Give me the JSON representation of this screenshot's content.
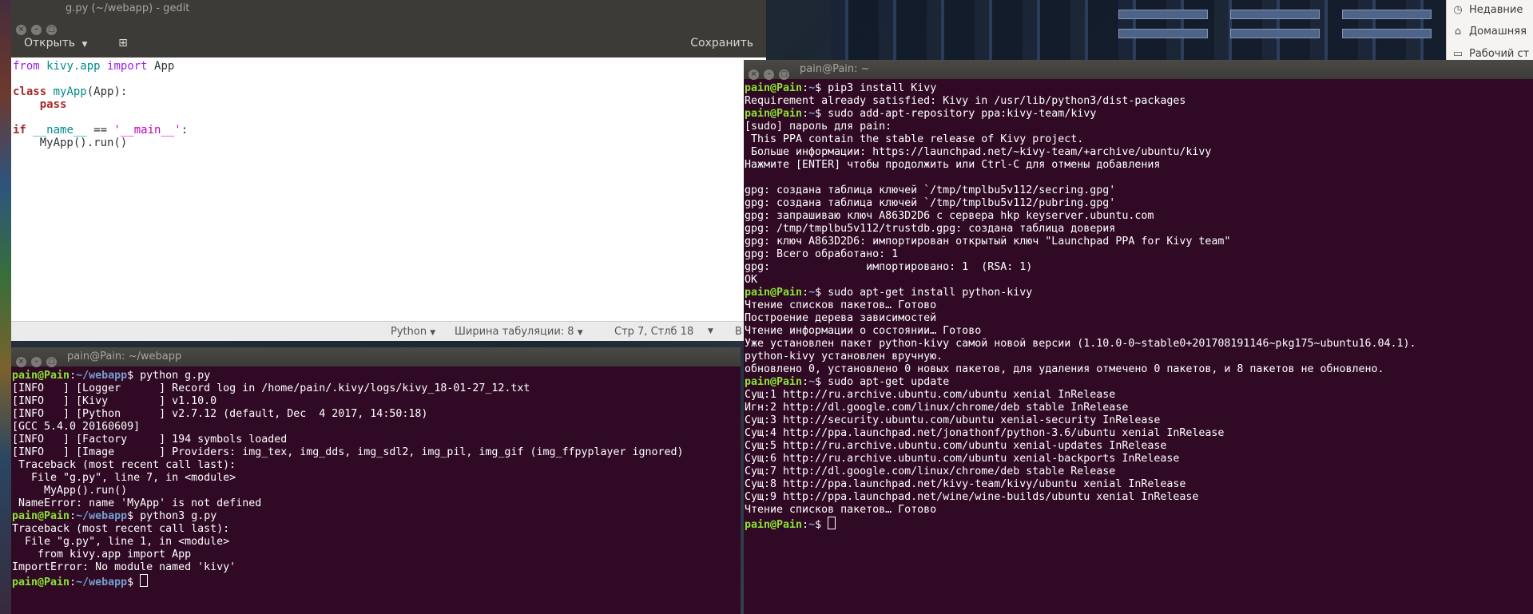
{
  "desktop": {
    "file_manager": {
      "items": [
        {
          "icon": "clock-icon",
          "label": "Недавние"
        },
        {
          "icon": "home-icon",
          "label": "Домашняя"
        },
        {
          "icon": "desktop-icon",
          "label": "Рабочий ст"
        }
      ]
    }
  },
  "gedit": {
    "title": "g.py (~/webapp) - gedit",
    "open_label": "Открыть",
    "save_label": "Сохранить",
    "code": [
      "from kivy.app import App",
      "",
      "class myApp(App):",
      "    pass",
      "",
      "if __name__ == '__main__':",
      "    MyApp().run()"
    ],
    "status": {
      "language": "Python",
      "tab_width": "Ширина табуляции: 8",
      "position": "Стр 7, Стлб 18",
      "insert_mode": "В"
    }
  },
  "terminal_left": {
    "title": "pain@Pain: ~/webapp",
    "lines": [
      {
        "prompt_user": "pain@Pain",
        "prompt_path": "~/webapp",
        "cmd": " python g.py"
      },
      {
        "text": "[INFO   ] [Logger      ] Record log in /home/pain/.kivy/logs/kivy_18-01-27_12.txt"
      },
      {
        "text": "[INFO   ] [Kivy        ] v1.10.0"
      },
      {
        "text": "[INFO   ] [Python      ] v2.7.12 (default, Dec  4 2017, 14:50:18)"
      },
      {
        "text": "[GCC 5.4.0 20160609]"
      },
      {
        "text": "[INFO   ] [Factory     ] 194 symbols loaded"
      },
      {
        "text": "[INFO   ] [Image       ] Providers: img_tex, img_dds, img_sdl2, img_pil, img_gif (img_ffpyplayer ignored)"
      },
      {
        "text": " Traceback (most recent call last):"
      },
      {
        "text": "   File \"g.py\", line 7, in <module>"
      },
      {
        "text": "     MyApp().run()"
      },
      {
        "text": " NameError: name 'MyApp' is not defined"
      },
      {
        "prompt_user": "pain@Pain",
        "prompt_path": "~/webapp",
        "cmd": " python3 g.py"
      },
      {
        "text": "Traceback (most recent call last):"
      },
      {
        "text": "  File \"g.py\", line 1, in <module>"
      },
      {
        "text": "    from kivy.app import App"
      },
      {
        "text": "ImportError: No module named 'kivy'"
      },
      {
        "prompt_user": "pain@Pain",
        "prompt_path": "~/webapp",
        "cmd": " ",
        "cursor": true
      }
    ]
  },
  "terminal_right": {
    "title": "pain@Pain: ~",
    "lines": [
      {
        "prompt_user": "pain@Pain",
        "prompt_path": "~",
        "cmd": " pip3 install Kivy"
      },
      {
        "text": "Requirement already satisfied: Kivy in /usr/lib/python3/dist-packages"
      },
      {
        "prompt_user": "pain@Pain",
        "prompt_path": "~",
        "cmd": " sudo add-apt-repository ppa:kivy-team/kivy"
      },
      {
        "text": "[sudo] пароль для pain:"
      },
      {
        "text": " This PPA contain the stable release of Kivy project."
      },
      {
        "text": " Больше информации: https://launchpad.net/~kivy-team/+archive/ubuntu/kivy"
      },
      {
        "text": "Нажмите [ENTER] чтобы продолжить или Ctrl-C для отмены добавления"
      },
      {
        "text": ""
      },
      {
        "text": "gpg: создана таблица ключей `/tmp/tmplbu5v112/secring.gpg'"
      },
      {
        "text": "gpg: создана таблица ключей `/tmp/tmplbu5v112/pubring.gpg'"
      },
      {
        "text": "gpg: запрашиваю ключ A863D2D6 с сервера hkp keyserver.ubuntu.com"
      },
      {
        "text": "gpg: /tmp/tmplbu5v112/trustdb.gpg: создана таблица доверия"
      },
      {
        "text": "gpg: ключ A863D2D6: импортирован открытый ключ \"Launchpad PPA for Kivy team\""
      },
      {
        "text": "gpg: Всего обработано: 1"
      },
      {
        "text": "gpg:               импортировано: 1  (RSA: 1)"
      },
      {
        "text": "OK"
      },
      {
        "prompt_user": "pain@Pain",
        "prompt_path": "~",
        "cmd": " sudo apt-get install python-kivy"
      },
      {
        "text": "Чтение списков пакетов… Готово"
      },
      {
        "text": "Построение дерева зависимостей"
      },
      {
        "text": "Чтение информации о состоянии… Готово"
      },
      {
        "text": "Уже установлен пакет python-kivy самой новой версии (1.10.0-0~stable0+201708191146~pkg175~ubuntu16.04.1)."
      },
      {
        "text": "python-kivy установлен вручную."
      },
      {
        "text": "обновлено 0, установлено 0 новых пакетов, для удаления отмечено 0 пакетов, и 8 пакетов не обновлено."
      },
      {
        "prompt_user": "pain@Pain",
        "prompt_path": "~",
        "cmd": " sudo apt-get update"
      },
      {
        "text": "Сущ:1 http://ru.archive.ubuntu.com/ubuntu xenial InRelease"
      },
      {
        "text": "Игн:2 http://dl.google.com/linux/chrome/deb stable InRelease"
      },
      {
        "text": "Сущ:3 http://security.ubuntu.com/ubuntu xenial-security InRelease"
      },
      {
        "text": "Сущ:4 http://ppa.launchpad.net/jonathonf/python-3.6/ubuntu xenial InRelease"
      },
      {
        "text": "Сущ:5 http://ru.archive.ubuntu.com/ubuntu xenial-updates InRelease"
      },
      {
        "text": "Сущ:6 http://ru.archive.ubuntu.com/ubuntu xenial-backports InRelease"
      },
      {
        "text": "Сущ:7 http://dl.google.com/linux/chrome/deb stable Release"
      },
      {
        "text": "Сущ:8 http://ppa.launchpad.net/kivy-team/kivy/ubuntu xenial InRelease"
      },
      {
        "text": "Сущ:9 http://ppa.launchpad.net/wine/wine-builds/ubuntu xenial InRelease"
      },
      {
        "text": "Чтение списков пакетов… Готово"
      },
      {
        "prompt_user": "pain@Pain",
        "prompt_path": "~",
        "cmd": " ",
        "cursor": true
      }
    ]
  },
  "colors": {
    "terminal_bg": "#300a24",
    "prompt_user": "#8ae234",
    "prompt_path": "#729fcf",
    "titlebar": "#3c3b37"
  }
}
